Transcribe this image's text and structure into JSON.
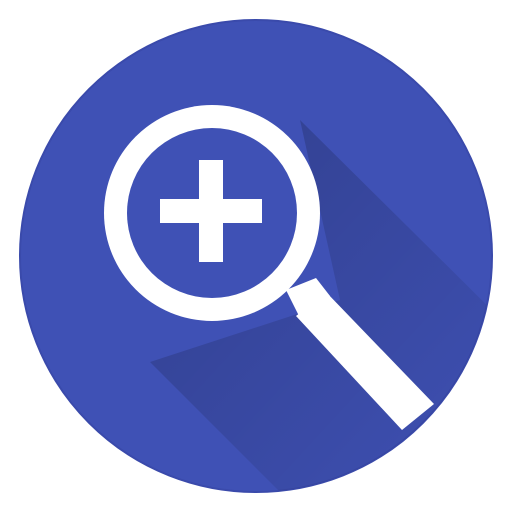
{
  "app_icon": {
    "icon": "magnifier-zoom-in-icon",
    "description_visible": false,
    "colors": {
      "background": "#ffffff",
      "circle": "#3f51b5",
      "circle_edge": "#3a4aab",
      "glyph": "#ffffff",
      "long_shadow": "#2f3d8f"
    }
  }
}
